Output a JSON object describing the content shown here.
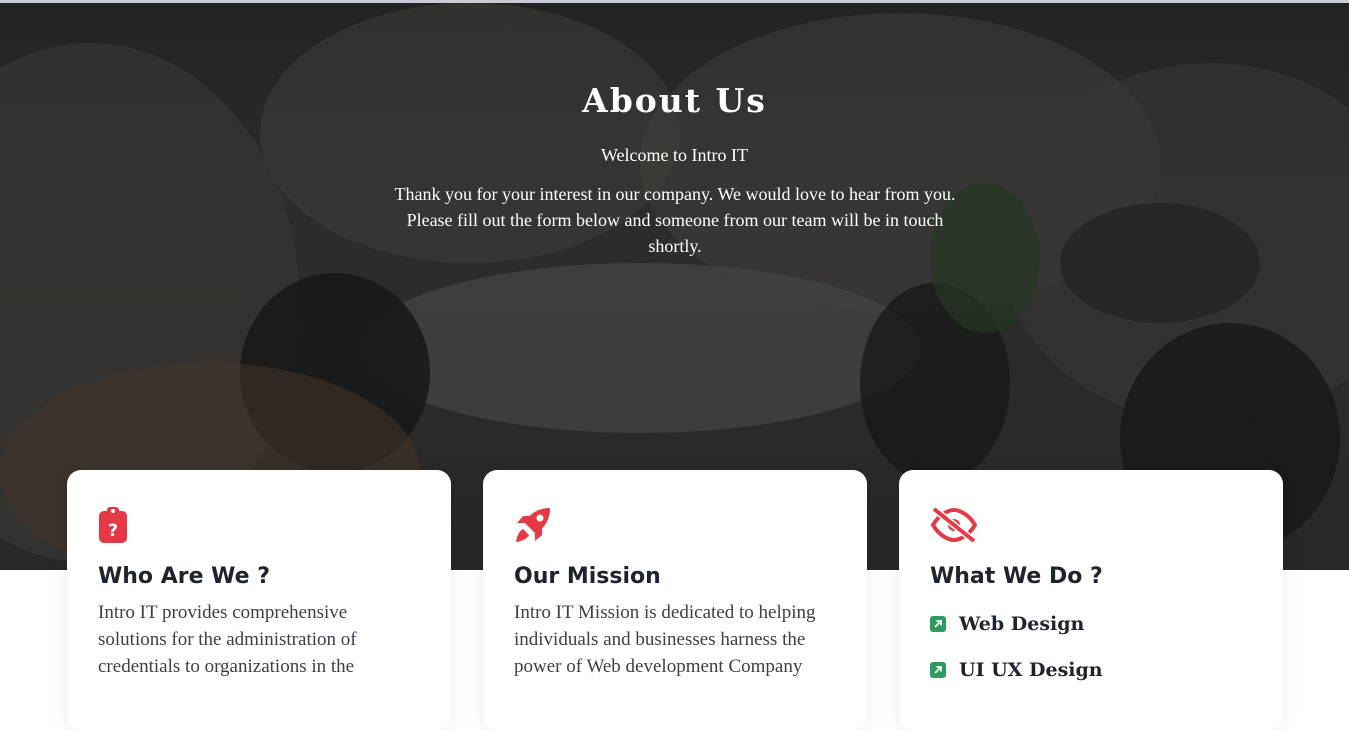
{
  "hero": {
    "title": "About Us",
    "subtitle": "Welcome to Intro IT",
    "text": "Thank you for your interest in our company. We would love to hear from you. Please fill out the form below and someone from our team will be in touch shortly."
  },
  "cards": [
    {
      "icon": "clipboard-question-icon",
      "title": "Who Are We ?",
      "text": "Intro IT provides comprehensive solutions for the administration of credentials to organizations in the"
    },
    {
      "icon": "rocket-icon",
      "title": "Our Mission",
      "text": "Intro IT Mission is dedicated to helping individuals and businesses harness the power of Web development Company"
    },
    {
      "icon": "eye-slash-icon",
      "title": "What We Do ?",
      "items": [
        "Web Design",
        "UI UX Design"
      ]
    }
  ],
  "colors": {
    "accent": "#e63946",
    "list_icon": "#2e9b5e",
    "heading": "#1f232b"
  }
}
